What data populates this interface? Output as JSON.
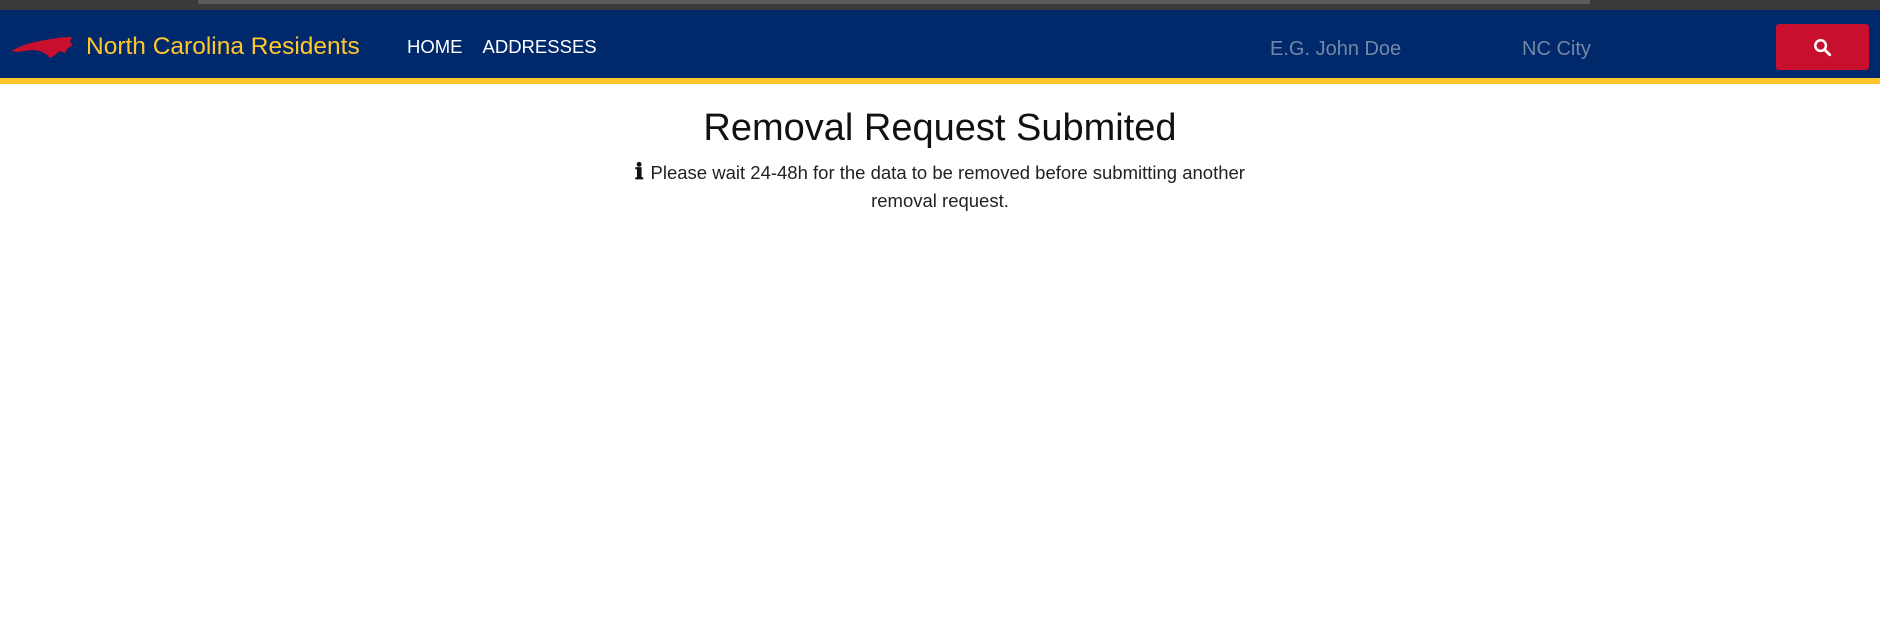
{
  "header": {
    "brand_name": "North Carolina Residents",
    "logo_icon": "nc-state-map-icon",
    "nav": [
      {
        "label": "HOME"
      },
      {
        "label": "ADDRESSES"
      }
    ],
    "search": {
      "name_placeholder": "E.G. John Doe",
      "city_placeholder": "NC City",
      "button_icon": "search-icon"
    },
    "colors": {
      "navbar_bg": "#00296b",
      "brand_text": "#ffc72c",
      "accent_border": "#ffc72c",
      "search_button": "#c8102e"
    }
  },
  "main": {
    "title": "Removal Request Submited",
    "info_icon": "ℹ",
    "notice": "Please wait 24-48h for the data to be removed before submitting another removal request."
  }
}
